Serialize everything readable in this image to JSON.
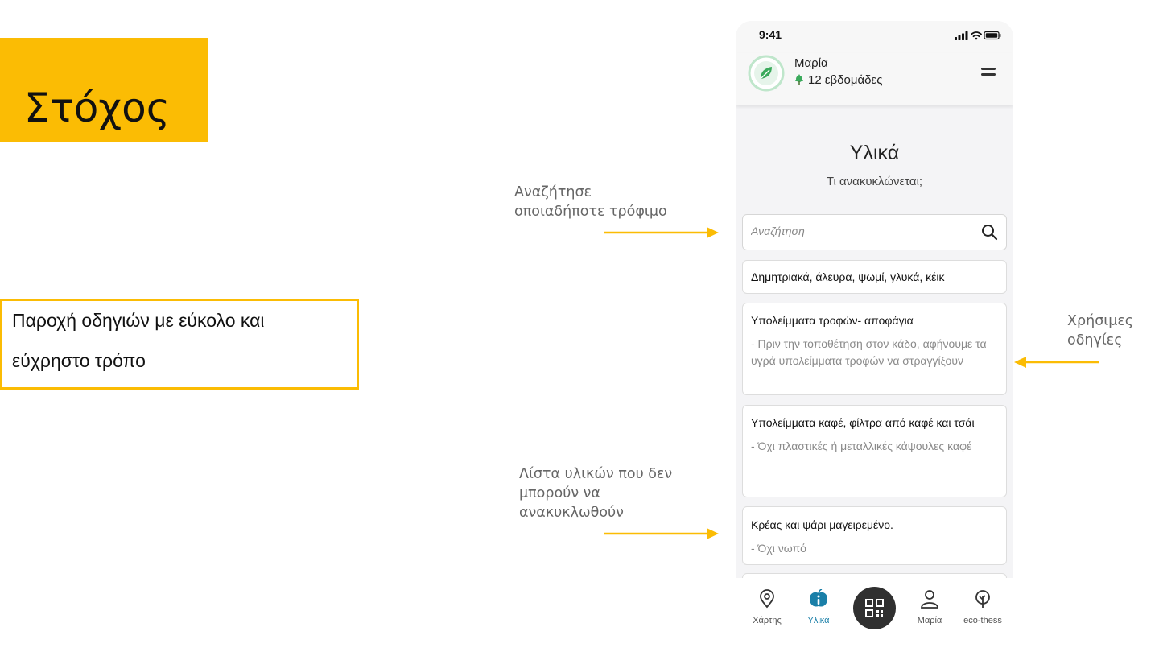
{
  "slide": {
    "title": "Στόχος",
    "goal_line1": "Παροχή οδηγιών με εύκολο και",
    "goal_line2": "εύχρηστο τρόπο",
    "annot_search_line1": "Αναζήτησε",
    "annot_search_line2": "οποιαδήποτε τρόφιμο",
    "annot_guides_line1": "Χρήσιμες",
    "annot_guides_line2": "οδηγίες",
    "annot_list_line1": "Λίστα υλικών που δεν",
    "annot_list_line2": "μπορούν να",
    "annot_list_line3": "ανακυκλωθούν",
    "accent_color": "#FBBC04"
  },
  "app": {
    "status_time": "9:41",
    "user_name": "Μαρία",
    "user_weeks": "12 εβδομάδες",
    "page_title": "Υλικά",
    "page_subtitle": "Τι ανακυκλώνεται;",
    "search_placeholder": "Αναζήτηση",
    "items": [
      {
        "title": "Δημητριακά, άλευρα, ψωμί, γλυκά, κέικ",
        "desc": ""
      },
      {
        "title": "Υπολείμματα τροφών- αποφάγια",
        "desc": "- Πριν την τοποθέτηση στον κάδο, αφήνουμε τα υγρά υπολείμματα τροφών να στραγγίξουν"
      },
      {
        "title": "Υπολείμματα καφέ, φίλτρα από καφέ και τσάι",
        "desc": "- Όχι πλαστικές ή μεταλλικές κάψουλες καφέ"
      },
      {
        "title": "Κρέας και ψάρι μαγειρεμένο.",
        "desc": "- Όχι νωπό"
      }
    ],
    "tabs": {
      "map": "Χάρτης",
      "materials": "Υλικά",
      "profile": "Μαρία",
      "eco": "eco-thess"
    },
    "active_tab_color": "#1A7FA8",
    "leaf_color": "#3BAA5C"
  }
}
